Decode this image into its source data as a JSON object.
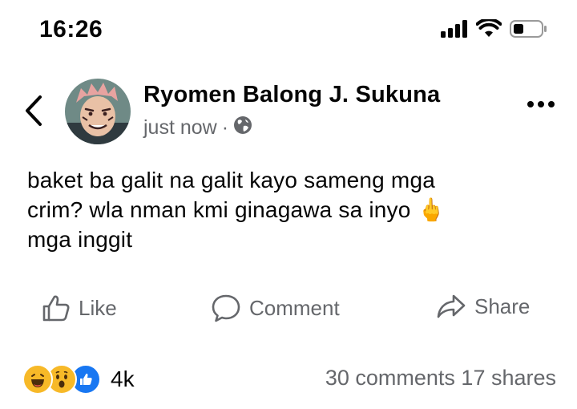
{
  "status_bar": {
    "time": "16:26"
  },
  "post": {
    "author": "Ryomen Balong J. Sukuna",
    "timestamp": "just now",
    "separator": "·",
    "audience_icon": "globe-icon",
    "text_lines": [
      "baket ba galit na galit kayo sameng mga",
      "crim? wla nman kmi ginagawa sa inyo 🖕",
      "mga inggit"
    ]
  },
  "actions": {
    "like_label": "Like",
    "comment_label": "Comment",
    "share_label": "Share"
  },
  "footer": {
    "reactions": [
      "haha",
      "wow",
      "like"
    ],
    "reaction_count": "4k",
    "comments_shares": "30 comments 17 shares"
  },
  "colors": {
    "text": "#050505",
    "secondary_text": "#65676b",
    "like_blue": "#1877f2",
    "emoji_yellow": "#f7b928"
  }
}
